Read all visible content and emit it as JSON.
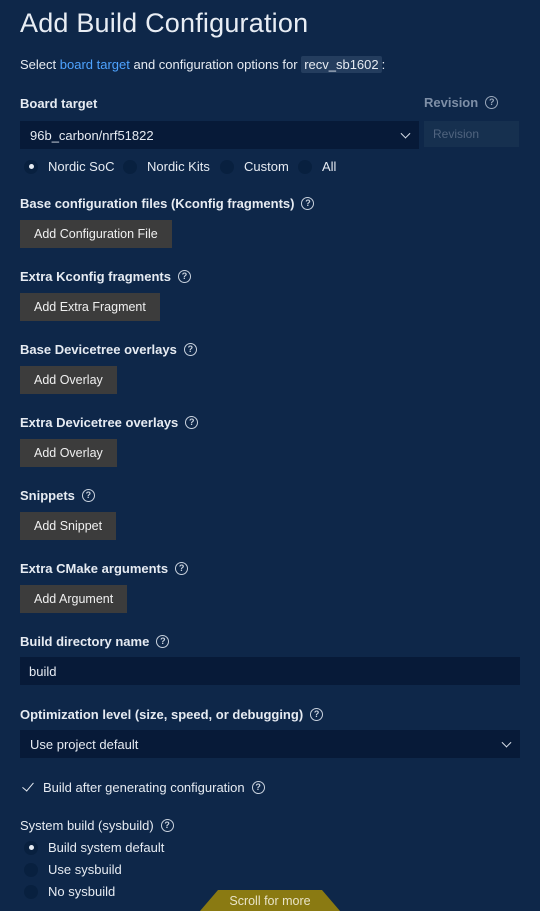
{
  "header": {
    "title": "Add Build Configuration",
    "subtitle_prefix": "Select",
    "subtitle_link": "board target",
    "subtitle_middle": "and configuration options for",
    "app_name": "recv_sb1602",
    "subtitle_suffix": ":"
  },
  "board_target": {
    "label": "Board target",
    "value": "96b_carbon/nrf51822",
    "revision_label": "Revision",
    "revision_placeholder": "Revision",
    "filters": [
      {
        "label": "Nordic SoC",
        "checked": true
      },
      {
        "label": "Nordic Kits",
        "checked": false
      },
      {
        "label": "Custom",
        "checked": false
      },
      {
        "label": "All",
        "checked": false
      }
    ]
  },
  "base_config": {
    "label": "Base configuration files (Kconfig fragments)",
    "button": "Add Configuration File"
  },
  "extra_kconfig": {
    "label": "Extra Kconfig fragments",
    "button": "Add Extra Fragment"
  },
  "base_devicetree": {
    "label": "Base Devicetree overlays",
    "button": "Add Overlay"
  },
  "extra_devicetree": {
    "label": "Extra Devicetree overlays",
    "button": "Add Overlay"
  },
  "snippets": {
    "label": "Snippets",
    "button": "Add Snippet"
  },
  "cmake": {
    "label": "Extra CMake arguments",
    "button": "Add Argument"
  },
  "build_dir": {
    "label": "Build directory name",
    "value": "build"
  },
  "optimization": {
    "label": "Optimization level (size, speed, or debugging)",
    "value": "Use project default"
  },
  "build_after": {
    "label": "Build after generating configuration",
    "checked": true
  },
  "sysbuild": {
    "label": "System build (sysbuild)",
    "options": [
      {
        "label": "Build system default",
        "checked": true
      },
      {
        "label": "Use sysbuild",
        "checked": false
      },
      {
        "label": "No sysbuild",
        "checked": false
      }
    ]
  },
  "scroll_hint": "Scroll for more",
  "colors": {
    "background": "#0e2749",
    "link": "#4ea3ff",
    "button": "#3c3c3c",
    "banner": "#8a7a12"
  }
}
